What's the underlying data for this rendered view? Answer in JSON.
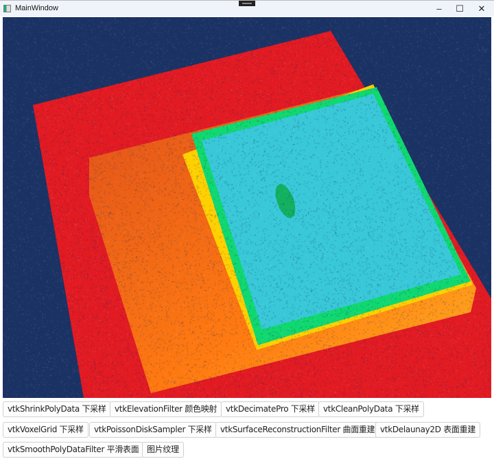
{
  "window": {
    "title": "MainWindow",
    "minimize_icon": "–",
    "maximize_icon": "☐",
    "close_icon": "✕"
  },
  "viewport": {
    "background": "#1b3264",
    "description_colors": [
      "#e41a1c",
      "#ff6a00",
      "#ffd000",
      "#00e060",
      "#30d0e0"
    ]
  },
  "buttons": [
    {
      "label": "vtkShrinkPolyData 下采样"
    },
    {
      "label": "vtkElevationFilter 颜色映射"
    },
    {
      "label": "vtkDecimatePro 下采样"
    },
    {
      "label": "vtkCleanPolyData 下采样"
    },
    {
      "label": "vtkVoxelGrid 下采样"
    },
    {
      "label": "vtkPoissonDiskSampler 下采样"
    },
    {
      "label": "vtkSurfaceReconstructionFilter 曲面重建"
    },
    {
      "label": "vtkDelaunay2D 表面重建"
    },
    {
      "label": "vtkSmoothPolyDataFilter 平滑表面"
    },
    {
      "label": "图片纹理"
    }
  ]
}
